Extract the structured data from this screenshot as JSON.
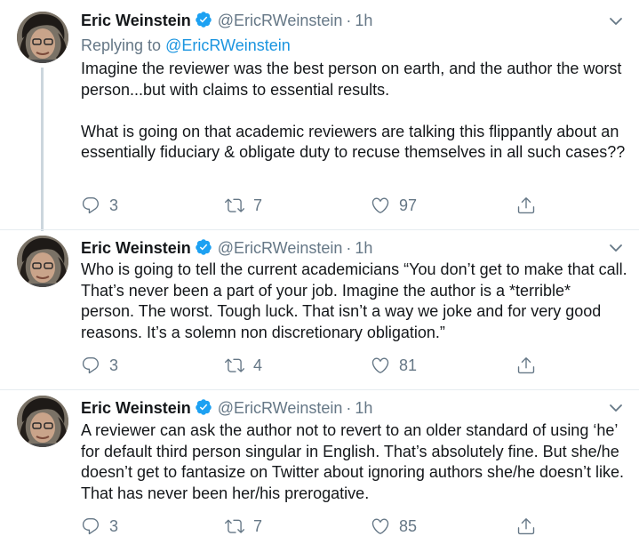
{
  "author": {
    "name": "Eric Weinstein",
    "handle": "@EricRWeinstein",
    "dot": "·",
    "time": "1h"
  },
  "tweets": [
    {
      "replying_prefix": "Replying to",
      "replying_handle": "@EricRWeinstein",
      "paragraphs": [
        "Imagine the reviewer was the best person on earth, and the author the worst person...but with claims to essential results.",
        "What is going on that academic reviewers are talking this flippantly about an essentially fiduciary & obligate duty to recuse themselves in all such cases??"
      ],
      "replies": "3",
      "retweets": "7",
      "likes": "97"
    },
    {
      "paragraphs": [
        "Who is going to tell the current academicians “You don’t get to make that call. That’s never been a part of your job. Imagine the author is a *terrible* person. The worst. Tough luck. That isn’t a way we joke and for very good reasons. It’s a solemn non discretionary obligation.”"
      ],
      "replies": "3",
      "retweets": "4",
      "likes": "81"
    },
    {
      "paragraphs": [
        "A reviewer can ask the author not to revert to an older standard of using ‘he’ for default third person singular in English. That’s absolutely fine. But she/he doesn’t get to fantasize on Twitter about ignoring authors she/he doesn’t like. That has never been her/his prerogative."
      ],
      "replies": "3",
      "retweets": "7",
      "likes": "85"
    }
  ],
  "colors": {
    "text": "#14171a",
    "secondary": "#657786",
    "link": "#1b95e0",
    "verified": "#1da1f2",
    "divider": "#e6ecf0",
    "thread_line": "#ccd6dd"
  },
  "icons": [
    "verified-badge-icon",
    "chevron-down-icon",
    "reply-icon",
    "retweet-icon",
    "like-icon",
    "share-icon"
  ]
}
